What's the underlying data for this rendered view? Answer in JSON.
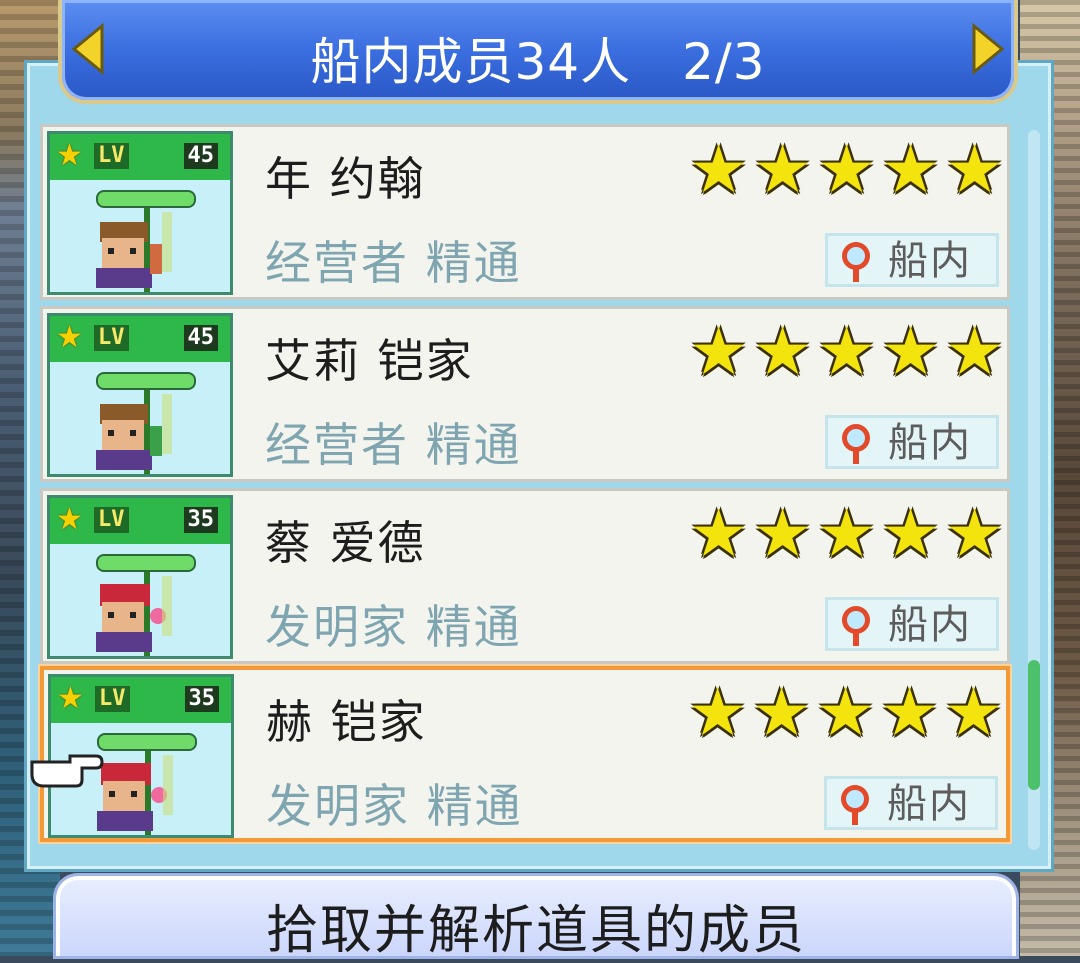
{
  "header": {
    "title": "船内成员34人　2/3",
    "prev_icon": "arrow-left-icon",
    "next_icon": "arrow-right-icon"
  },
  "members": [
    {
      "name": "年 约翰",
      "level": "45",
      "job": "经营者 精通",
      "stars": 5,
      "location": "船内",
      "hair": "brown"
    },
    {
      "name": "艾莉 铠家",
      "level": "45",
      "job": "经营者 精通",
      "stars": 5,
      "location": "船内",
      "hair": "brown"
    },
    {
      "name": "蔡 爱德",
      "level": "35",
      "job": "发明家 精通",
      "stars": 5,
      "location": "船内",
      "hair": "red"
    },
    {
      "name": "赫 铠家",
      "level": "35",
      "job": "发明家 精通",
      "stars": 5,
      "location": "船内",
      "hair": "red",
      "selected": true
    }
  ],
  "level_prefix": "LV",
  "footer": {
    "label": "拾取并解析道具的成员"
  },
  "colors": {
    "accent_header": "#3b6ee0",
    "selection_border": "#f29a3a",
    "star": "#f2e40c",
    "level_bar": "#2fb84a"
  }
}
